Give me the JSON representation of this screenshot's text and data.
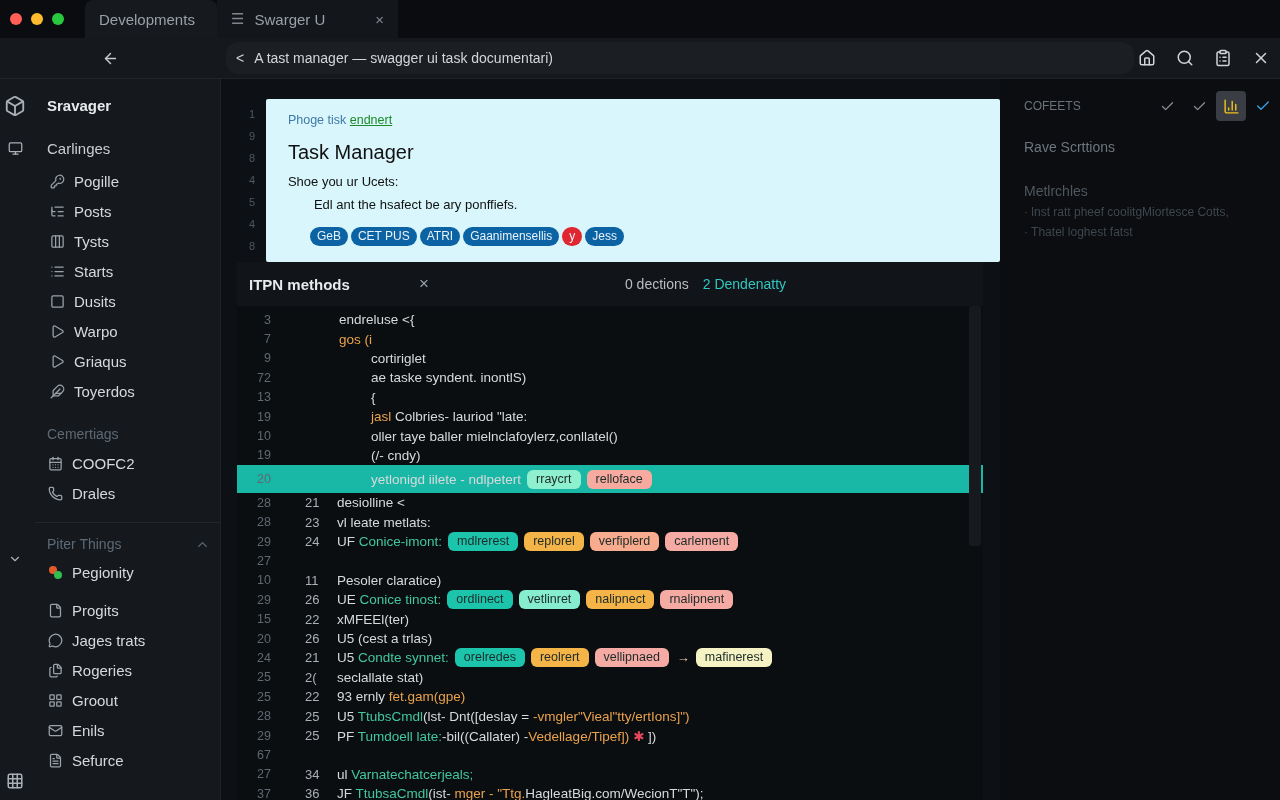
{
  "window_tabs": [
    {
      "label": "Developments",
      "selected": true
    },
    {
      "label": "Swarger U",
      "selected": false,
      "icon_char": "☰",
      "close_char": "×"
    }
  ],
  "address_bar": {
    "back_char": "<",
    "value": "A tast manager — swagger ui task documentari)"
  },
  "sidebar": {
    "title": "Sravager",
    "section": "Carlinges",
    "items": [
      {
        "label": "Pogille"
      },
      {
        "label": "Posts"
      },
      {
        "label": "Tysts"
      },
      {
        "label": "Starts"
      },
      {
        "label": "Dusits"
      },
      {
        "label": "Warpo"
      },
      {
        "label": "Griaqus"
      },
      {
        "label": "Toyerdos"
      }
    ],
    "group": {
      "label": "Cemertiags",
      "items": [
        {
          "label": "COOFC2"
        },
        {
          "label": "Drales"
        }
      ]
    },
    "collapsible": {
      "label": "Piter Things",
      "expanded": true,
      "items": [
        {
          "label": "Pegionity"
        },
        {
          "label": "Progits"
        },
        {
          "label": "Jages trats"
        },
        {
          "label": "Rogeries"
        },
        {
          "label": "Groout"
        },
        {
          "label": "Enils"
        },
        {
          "label": "Sefurce"
        }
      ]
    }
  },
  "card": {
    "gutter": [
      "1",
      "9",
      "8",
      "4",
      "5",
      "4",
      "8"
    ],
    "intro": "Phoge tisk ",
    "intro_link": "endnert",
    "title": "Task Manager",
    "subtitle": "Shoe you ur Ucets:",
    "description": "Edl ant the hsafect be ary ponffiefs.",
    "chips": [
      {
        "label": "GeB",
        "color": "#0b63a3"
      },
      {
        "label": "CET PUS",
        "color": "#0b63a3"
      },
      {
        "label": "ATRI",
        "color": "#0b63a3"
      },
      {
        "label": "Gaanimensellis",
        "color": "#0b63a3"
      },
      {
        "label": "y",
        "color": "#e0262f"
      },
      {
        "label": "Jess",
        "color": "#0b63a3"
      }
    ]
  },
  "panel": {
    "title": "ITPN methods",
    "close_char": "×",
    "stat": "0 dections",
    "stat_link": "2 Dendenatty"
  },
  "code_lines": [
    {
      "number": "3",
      "highlighted": false,
      "nested": false,
      "parts": [
        {
          "text": "endreluse <{",
          "kind": "plain"
        }
      ]
    },
    {
      "number": "7",
      "highlighted": false,
      "nested": false,
      "parts": [
        {
          "text": "gos (i",
          "kind": "keyword"
        }
      ]
    },
    {
      "number": "9",
      "highlighted": false,
      "nested": true,
      "parts": [
        {
          "text": "cortiriglet",
          "kind": "plain"
        }
      ]
    },
    {
      "number": "72",
      "highlighted": false,
      "nested": true,
      "parts": [
        {
          "text": "ae taske syndent. inontlS)",
          "kind": "plain"
        }
      ]
    },
    {
      "number": "13",
      "highlighted": false,
      "nested": true,
      "parts": [
        {
          "text": "{",
          "kind": "plain"
        }
      ]
    },
    {
      "number": "19",
      "highlighted": false,
      "nested": true,
      "parts": [
        {
          "text": "jasl",
          "kind": "keyword"
        },
        {
          "text": " Colbries- lauriod \"late:",
          "kind": "plain"
        }
      ]
    },
    {
      "number": "10",
      "highlighted": false,
      "nested": true,
      "parts": [
        {
          "text": "oller taye baller mielnclafoylerz,conllatel()",
          "kind": "plain"
        }
      ]
    },
    {
      "number": "19",
      "highlighted": false,
      "nested": true,
      "parts": [
        {
          "text": "(/- cndy)",
          "kind": "plain"
        }
      ]
    },
    {
      "number": "20",
      "highlighted": true,
      "nested": true,
      "parts": [
        {
          "text": "yetlonigd iilete - ndlpetert",
          "kind": "plain"
        }
      ],
      "tags": [
        {
          "kind": "chip",
          "text": "rraycrt",
          "color": "#8ff0cf"
        },
        {
          "kind": "chip",
          "text": "relloface",
          "color": "#f7aaa0"
        }
      ]
    },
    {
      "number": "28",
      "number2": "21",
      "highlighted": false,
      "parts": [
        {
          "text": "desiolline <",
          "kind": "plain"
        }
      ]
    },
    {
      "number": "28",
      "number2": "23",
      "highlighted": false,
      "parts": [
        {
          "text": "vl leate metlats:",
          "kind": "plain"
        }
      ]
    },
    {
      "number": "29",
      "number2": "24",
      "highlighted": false,
      "parts": [
        {
          "text": "UF ",
          "kind": "plain"
        },
        {
          "text": "Conice-imont:",
          "kind": "string"
        }
      ],
      "tags": [
        {
          "kind": "chip",
          "text": "mdlrerest",
          "color": "#1cc4ab"
        },
        {
          "kind": "chip",
          "text": "replorel",
          "color": "#f4b447"
        },
        {
          "kind": "chip",
          "text": "verfiplerd",
          "color": "#f8ab8e"
        },
        {
          "kind": "chip",
          "text": "carlement",
          "color": "#f5aaa3"
        }
      ]
    },
    {
      "number": "27",
      "highlighted": false
    },
    {
      "number": "10",
      "number2": "11",
      "highlighted": false,
      "parts": [
        {
          "text": "Pesoler claratice)",
          "kind": "plain"
        }
      ]
    },
    {
      "number": "29",
      "number2": "26",
      "highlighted": false,
      "parts": [
        {
          "text": "UE ",
          "kind": "plain"
        },
        {
          "text": "Conice tinost:",
          "kind": "string"
        }
      ],
      "tags": [
        {
          "kind": "chip",
          "text": "ordlinect",
          "color": "#1cc4ab"
        },
        {
          "kind": "chip",
          "text": "vetlinret",
          "color": "#86edcf"
        },
        {
          "kind": "chip",
          "text": "nalipnect",
          "color": "#f4b447"
        },
        {
          "kind": "chip",
          "text": "rnalipnent",
          "color": "#f5aaa3"
        }
      ]
    },
    {
      "number": "15",
      "number2": "22",
      "highlighted": false,
      "parts": [
        {
          "text": "xMFEEl(ter)",
          "kind": "plain"
        }
      ]
    },
    {
      "number": "20",
      "number2": "26",
      "highlighted": false,
      "parts": [
        {
          "text": "U5 (cest a trlas)",
          "kind": "plain"
        }
      ]
    },
    {
      "number": "24",
      "number2": "21",
      "highlighted": false,
      "parts": [
        {
          "text": "U5 ",
          "kind": "plain"
        },
        {
          "text": "Condte synnet:",
          "kind": "string"
        }
      ],
      "tags": [
        {
          "kind": "chip",
          "text": "orelredes",
          "color": "#1cc4ab"
        },
        {
          "kind": "chip",
          "text": "reolrert",
          "color": "#f4b447"
        },
        {
          "kind": "chip",
          "text": "vellipnaed",
          "color": "#f5aaa3"
        },
        {
          "kind": "arrow",
          "text": "→"
        },
        {
          "kind": "chip",
          "text": "mafinerest",
          "color": "#f5f3c4"
        }
      ]
    },
    {
      "number": "25",
      "number2": "2(",
      "highlighted": false,
      "parts": [
        {
          "text": "seclallate stat)",
          "kind": "plain"
        }
      ]
    },
    {
      "number": "25",
      "number2": "22",
      "highlighted": false,
      "parts": [
        {
          "text": "93 ernly ",
          "kind": "plain"
        },
        {
          "text": "fet.gam(gpe)",
          "kind": "keyword"
        }
      ]
    },
    {
      "number": "28",
      "number2": "25",
      "highlighted": false,
      "parts": [
        {
          "text": "U5 ",
          "kind": "plain"
        },
        {
          "text": "TtubsCmdl",
          "kind": "string"
        },
        {
          "text": "(lst- Dnt([deslay = ",
          "kind": "plain"
        },
        {
          "text": "-vmgler\"Vieal\"tty/ertIons]\")",
          "kind": "keyword"
        }
      ]
    },
    {
      "number": "29",
      "number2": "25",
      "highlighted": false,
      "parts": [
        {
          "text": "PF ",
          "kind": "plain"
        },
        {
          "text": "Tumdoell late:",
          "kind": "string"
        },
        {
          "text": "-bil((Callater) -",
          "kind": "plain"
        },
        {
          "text": "Vedellage/Tipef])",
          "kind": "keyword"
        },
        {
          "text": " ✱ ",
          "kind": "error"
        },
        {
          "text": "])",
          "kind": "plain"
        }
      ]
    },
    {
      "number": "67",
      "highlighted": false
    },
    {
      "number": "27",
      "number2": "34",
      "highlighted": false,
      "parts": [
        {
          "text": "ul ",
          "kind": "plain"
        },
        {
          "text": "Varnatechatcerjeals;",
          "kind": "string"
        }
      ]
    },
    {
      "number": "37",
      "number2": "36",
      "highlighted": false,
      "parts": [
        {
          "text": "JF ",
          "kind": "plain"
        },
        {
          "text": "TtubsaCmdl",
          "kind": "string"
        },
        {
          "text": "(ist- ",
          "kind": "plain"
        },
        {
          "text": "mger - \"Ttg.",
          "kind": "keyword"
        },
        {
          "text": "HagleatBig.com/WecionT\"T\");",
          "kind": "plain"
        }
      ]
    }
  ],
  "right_panel": {
    "label": "COFEETS",
    "tools": [
      {
        "kind": "check",
        "selected": false
      },
      {
        "kind": "check",
        "selected": false
      },
      {
        "kind": "chart",
        "selected": true
      },
      {
        "kind": "check-accent",
        "selected": false
      }
    ],
    "heading": "Rave Scrttions",
    "subheading": "Metlrchles",
    "bullets": [
      "· lnst ratt pheef coolitgMiortesce Cotts,",
      "· Thatel loghest fatst"
    ]
  }
}
